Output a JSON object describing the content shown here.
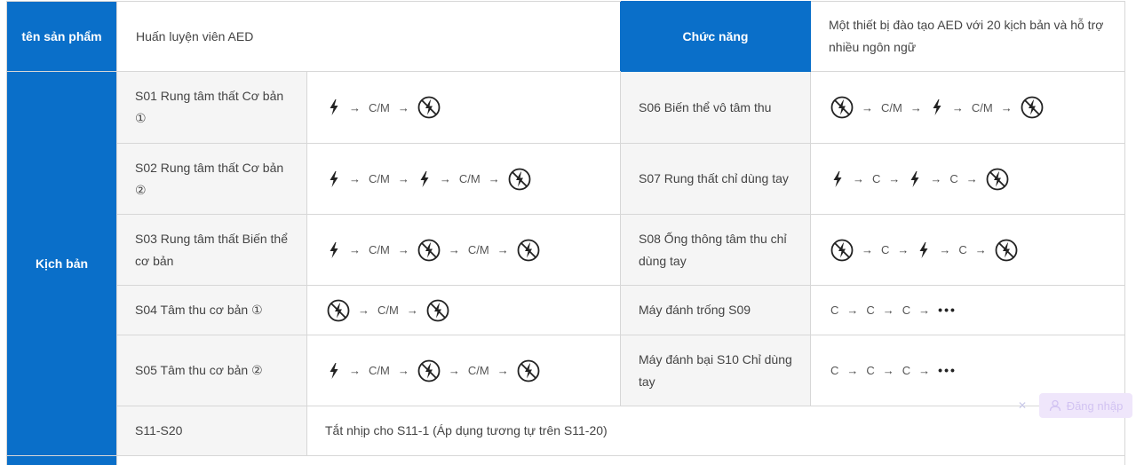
{
  "product": {
    "label": "tên sản phẩm",
    "value": "Huấn luyện viên AED",
    "function_label": "Chức năng",
    "function_value": "Một thiết bị đào tạo AED với 20 kịch bản và hỗ trợ nhiều ngôn ngữ"
  },
  "scenarios_label": "Kịch bản",
  "icons": {
    "shock": "lightning-bolt-icon",
    "no_shock": "no-shock-icon"
  },
  "rows": [
    {
      "left": {
        "name": "S01 Rung tâm thất Cơ bản ①",
        "seq": [
          "shock",
          "C/M",
          "noshock"
        ]
      },
      "right": {
        "name": "S06 Biến thể vô tâm thu",
        "seq": [
          "noshock",
          "C/M",
          "shock",
          "C/M",
          "noshock"
        ]
      }
    },
    {
      "left": {
        "name": "S02 Rung tâm thất Cơ bản ②",
        "seq": [
          "shock",
          "C/M",
          "shock",
          "C/M",
          "noshock"
        ]
      },
      "right": {
        "name": "S07 Rung thất chỉ dùng tay",
        "seq": [
          "shock",
          "C",
          "shock",
          "C",
          "noshock"
        ]
      }
    },
    {
      "left": {
        "name": "S03 Rung tâm thất Biến thể cơ bản",
        "seq": [
          "shock",
          "C/M",
          "noshock",
          "C/M",
          "noshock"
        ]
      },
      "right": {
        "name": "S08 Ống thông tâm thu chỉ dùng tay",
        "seq": [
          "noshock",
          "C",
          "shock",
          "C",
          "noshock"
        ]
      }
    },
    {
      "left": {
        "name": "S04 Tâm thu cơ bản ①",
        "seq": [
          "noshock",
          "C/M",
          "noshock"
        ]
      },
      "right": {
        "name": "Máy đánh trống S09",
        "seq": [
          "C",
          "C",
          "C",
          "dots"
        ]
      }
    },
    {
      "left": {
        "name": "S05 Tâm thu cơ bản ②",
        "seq": [
          "shock",
          "C/M",
          "noshock",
          "C/M",
          "noshock"
        ]
      },
      "right": {
        "name": "Máy đánh bại S10 Chỉ dùng tay",
        "seq": [
          "C",
          "C",
          "C",
          "dots"
        ]
      }
    }
  ],
  "last_row": {
    "name": "S11-S20",
    "value": "Tắt nhịp cho S11-1 (Áp dụng tương tự trên S11-20)"
  },
  "arrow_glyph": "→",
  "dots_glyph": "•••",
  "login": {
    "label": "Đăng nhập",
    "close_glyph": "✕"
  }
}
